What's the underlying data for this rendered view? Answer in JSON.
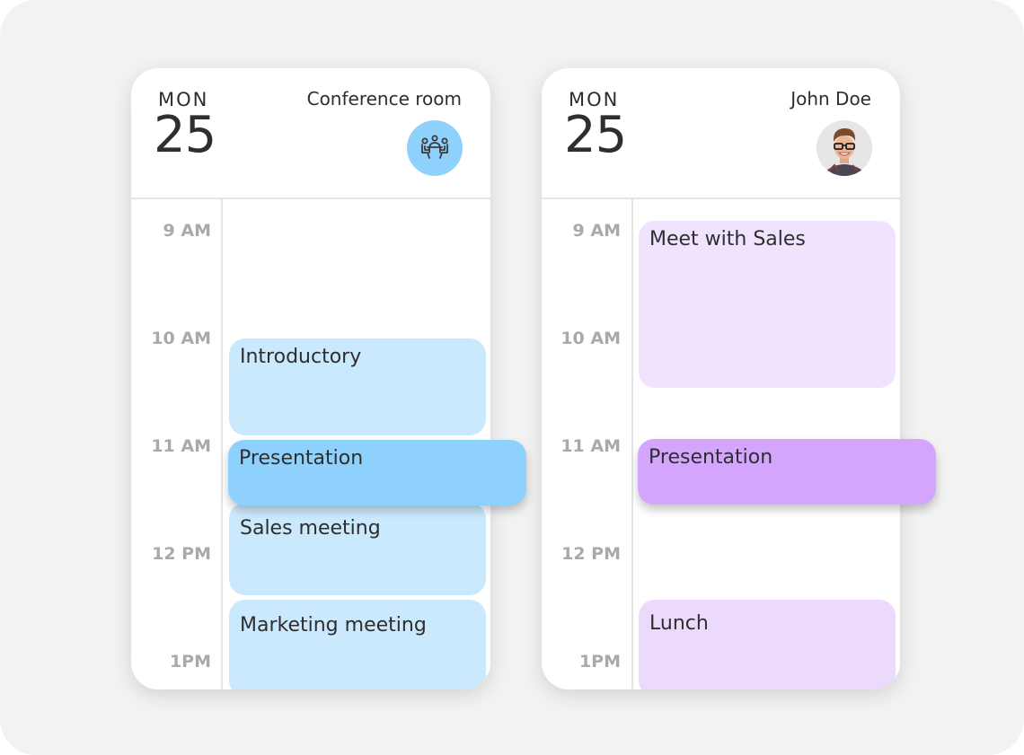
{
  "calendars": [
    {
      "day_of_week": "MON",
      "day_number": "25",
      "resource_name": "Conference room",
      "resource_icon": "meeting-room-icon",
      "time_labels": [
        "9 AM",
        "10 AM",
        "11 AM",
        "12 PM",
        "1PM"
      ],
      "events": [
        {
          "title": "Introductory",
          "color": "#cbe9fd"
        },
        {
          "title": "Presentation",
          "color": "#8fd1fd",
          "selected": true
        },
        {
          "title": "Sales meeting",
          "color": "#cbe9fd"
        },
        {
          "title": "Marketing meeting",
          "color": "#cbe9fd"
        }
      ]
    },
    {
      "day_of_week": "MON",
      "day_number": "25",
      "resource_name": "John Doe",
      "resource_icon": "user-avatar",
      "time_labels": [
        "9 AM",
        "10 AM",
        "11 AM",
        "12 PM",
        "1PM"
      ],
      "events": [
        {
          "title": "Meet with Sales",
          "color": "#f0e3fd"
        },
        {
          "title": "Presentation",
          "color": "#d4a5fd",
          "selected": true
        },
        {
          "title": "Lunch",
          "color": "#ecdafd"
        }
      ]
    }
  ],
  "colors": {
    "background": "#f2f2f2",
    "card": "#ffffff",
    "text": "#2e2e2e",
    "time_label": "#a9a9a9",
    "room_accent": "#8fd1fd",
    "person_accent": "#d4a5fd"
  }
}
